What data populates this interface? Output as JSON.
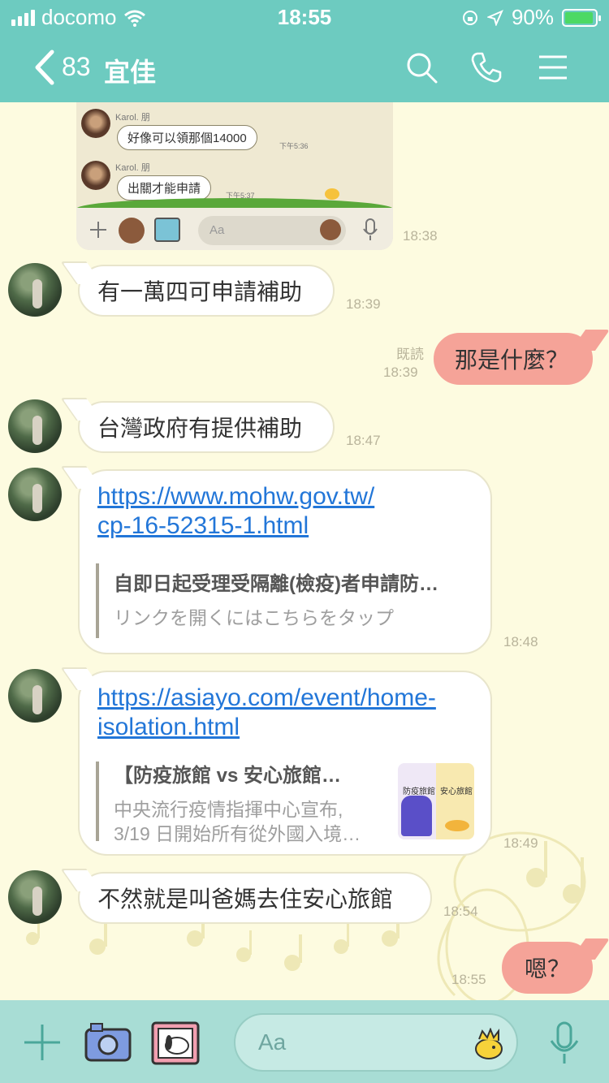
{
  "status_bar": {
    "carrier": "docomo",
    "time": "18:55",
    "battery": "90%"
  },
  "header": {
    "unread_count": "83",
    "contact_name": "宜佳",
    "icons": [
      "back-chevron-icon",
      "search-icon",
      "phone-icon",
      "menu-icon"
    ]
  },
  "shared_screenshot": {
    "messages": [
      {
        "name": "Karol. 朋",
        "text": "好像可以領那個14000",
        "time": "下午5:36"
      },
      {
        "name": "Karol. 朋",
        "text": "出關才能申請",
        "time": "下午5:37"
      }
    ],
    "input_placeholder": "Aa",
    "time": "18:38"
  },
  "messages": [
    {
      "dir": "in",
      "text": "有一萬四可申請補助",
      "time": "18:39"
    },
    {
      "dir": "out",
      "text": "那是什麼？",
      "time": "18:39",
      "read": "既読"
    },
    {
      "dir": "in",
      "text": "台灣政府有提供補助",
      "time": "18:47"
    },
    {
      "dir": "in",
      "link": "https://www.mohw.gov.tw/cp-16-52315-1.html",
      "link_line1": "https://www.mohw.gov.tw/",
      "link_line2": "cp-16-52315-1.html",
      "preview_title": "自即日起受理受隔離(檢疫)者申請防…",
      "preview_desc": "リンクを開くにはこちらをタップ",
      "time": "18:48"
    },
    {
      "dir": "in",
      "link": "https://asiayo.com/event/home-isolation.html",
      "link_line1": "https://asiayo.com/event/home-",
      "link_line2": "isolation.html",
      "preview_title": "【防疫旅館 vs 安心旅館…",
      "preview_desc_line1": "中央流行疫情指揮中心宣布,",
      "preview_desc_line2": "3/19 日開始所有從外國入境…",
      "thumb_text1": "防疫旅館",
      "thumb_text2": "安心旅館",
      "time": "18:49"
    },
    {
      "dir": "in",
      "text": "不然就是叫爸媽去住安心旅館",
      "time": "18:54"
    },
    {
      "dir": "out",
      "text": "嗯？",
      "time": "18:55"
    }
  ],
  "input_bar": {
    "placeholder": "Aa",
    "icons": [
      "plus-icon",
      "camera-icon",
      "photo-icon",
      "sticker-icon",
      "microphone-icon"
    ]
  },
  "colors": {
    "header": "#6dcbc0",
    "chat_bg": "#fdfbe0",
    "outgoing_bubble": "#f5a398",
    "link": "#2276d8",
    "input_bar": "#a8ddd5"
  }
}
